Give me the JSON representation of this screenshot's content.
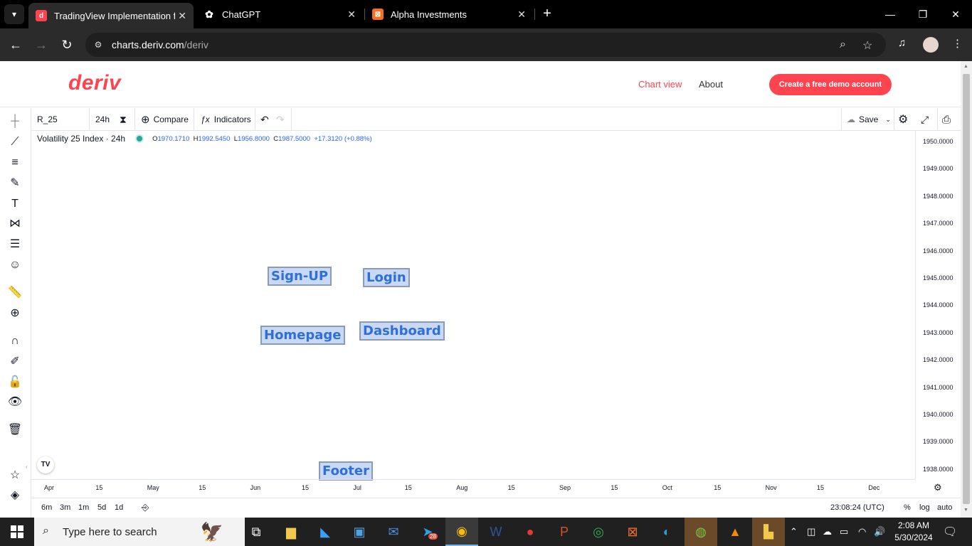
{
  "browser": {
    "tabs": [
      {
        "title": "TradingView Implementation fo",
        "favicon": "d",
        "color": "#ff444f"
      },
      {
        "title": "ChatGPT",
        "favicon": "✿",
        "color": "#ffffff"
      },
      {
        "title": "Alpha Investments",
        "favicon": "⊠",
        "color": "#f36f21"
      }
    ],
    "new_tab": "+",
    "url_host": "charts.deriv.com",
    "url_path": "/deriv",
    "win_controls": [
      "—",
      "❐",
      "✕"
    ]
  },
  "site": {
    "logo": "deriv",
    "nav": {
      "chart_view": "Chart view",
      "about": "About"
    },
    "cta": "Create a free demo account",
    "brand_color": "#ff444f"
  },
  "chart_toolbar": {
    "symbol": "R_25",
    "interval": "24h",
    "compare": "Compare",
    "indicators": "Indicators",
    "save": "Save"
  },
  "legend": {
    "name": "Volatility 25 Index · 24h",
    "o_label": "O",
    "o": "1970.1710",
    "h_label": "H",
    "h": "1992.5450",
    "l_label": "L",
    "l": "1956.8000",
    "c_label": "C",
    "c": "1987.5000",
    "change": "+17.3120 (+0.88%)"
  },
  "price_axis": [
    "1950.0000",
    "1949.0000",
    "1948.0000",
    "1947.0000",
    "1946.0000",
    "1945.0000",
    "1944.0000",
    "1943.0000",
    "1942.0000",
    "1941.0000",
    "1940.0000",
    "1939.0000",
    "1938.0000"
  ],
  "time_axis": [
    "Apr",
    "15",
    "May",
    "15",
    "Jun",
    "15",
    "Jul",
    "15",
    "Aug",
    "15",
    "Sep",
    "15",
    "Oct",
    "15",
    "Nov",
    "15",
    "Dec"
  ],
  "bottom": {
    "ranges": [
      "6m",
      "3m",
      "1m",
      "5d",
      "1d"
    ],
    "clock": "23:08:24 (UTC)",
    "percent": "%",
    "log": "log",
    "auto": "auto"
  },
  "overlays": {
    "signup": "Sign-UP",
    "login": "Login",
    "homepage": "Homepage",
    "dashboard": "Dashboard",
    "footer": "Footer"
  },
  "tv_logo": "TV",
  "taskbar": {
    "search_placeholder": "Type here to search",
    "telegram_badge": "28",
    "time": "2:08 AM",
    "date": "5/30/2024"
  }
}
